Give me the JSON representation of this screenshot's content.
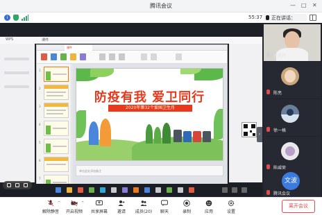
{
  "window": {
    "title": "腾讯会议",
    "controls": {
      "minimize": "—",
      "maximize": "□",
      "close": "✕"
    }
  },
  "infobar": {
    "clock": "55:37",
    "speaker_label": "正在讲话：",
    "icons": {
      "info": "info-icon",
      "security": "shield-icon",
      "network": "signal-icon",
      "layout": "grid-icon"
    }
  },
  "shared_screen": {
    "app_tabs": [
      "WPS",
      "课件"
    ],
    "slide": {
      "headline": "防疫有我  爱卫同行",
      "banner": "2020年第32个爱国卫生月"
    },
    "notes_placeholder": "单击此处添加备注"
  },
  "participants": [
    {
      "name": "王美丹",
      "mic": "on",
      "video": true
    },
    {
      "name": "陈亮",
      "mic": "off",
      "video": false
    },
    {
      "name": "徐一格",
      "mic": "off",
      "video": false
    },
    {
      "name": "陈威荣",
      "mic": "off",
      "video": false
    },
    {
      "name": "文文",
      "avatar_text": "文波",
      "label": "腾讯会议",
      "mic": "off"
    }
  ],
  "toolbar": {
    "items": [
      {
        "key": "mute",
        "label": "解除静音",
        "icon": "microphone-off-icon"
      },
      {
        "key": "video",
        "label": "开启视频",
        "icon": "camera-off-icon"
      },
      {
        "key": "share",
        "label": "共享屏幕",
        "icon": "share-screen-icon"
      },
      {
        "key": "manage",
        "label": "邀请",
        "icon": "invite-icon"
      },
      {
        "key": "members",
        "label": "成员(20)",
        "icon": "members-icon"
      },
      {
        "key": "chat",
        "label": "聊天",
        "icon": "chat-icon"
      },
      {
        "key": "record",
        "label": "录制",
        "icon": "record-icon"
      },
      {
        "key": "apps",
        "label": "应用",
        "icon": "apps-icon"
      },
      {
        "key": "settings",
        "label": "设置",
        "icon": "settings-icon"
      }
    ],
    "leave_label": "离开会议"
  },
  "colors": {
    "accent": "#3b7be0",
    "danger": "#e5484d",
    "slide_red": "#e8391c",
    "panel_bg": "#20232a"
  }
}
